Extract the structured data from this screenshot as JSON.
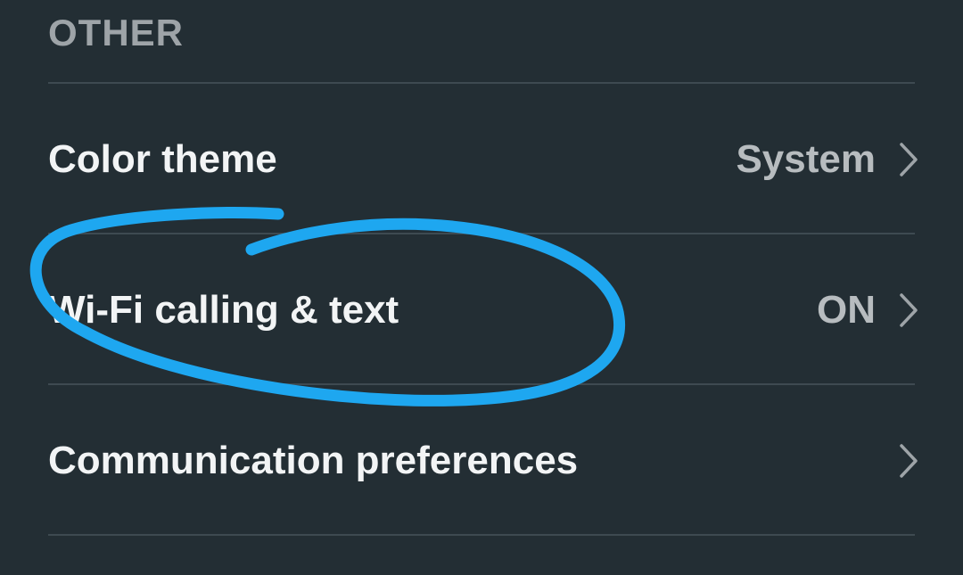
{
  "section": {
    "title": "OTHER"
  },
  "rows": [
    {
      "label": "Color theme",
      "value": "System",
      "icon": "chevron-right-icon"
    },
    {
      "label": "Wi-Fi calling & text",
      "value": "ON",
      "icon": "chevron-right-icon"
    },
    {
      "label": "Communication preferences",
      "value": "",
      "icon": "chevron-right-icon"
    }
  ],
  "colors": {
    "background": "#232e34",
    "divider": "#3e4a51",
    "header_text": "#9ea4a8",
    "label_text": "#f2f4f5",
    "value_text": "#b7bcbf",
    "annotation": "#1ea7f0"
  }
}
